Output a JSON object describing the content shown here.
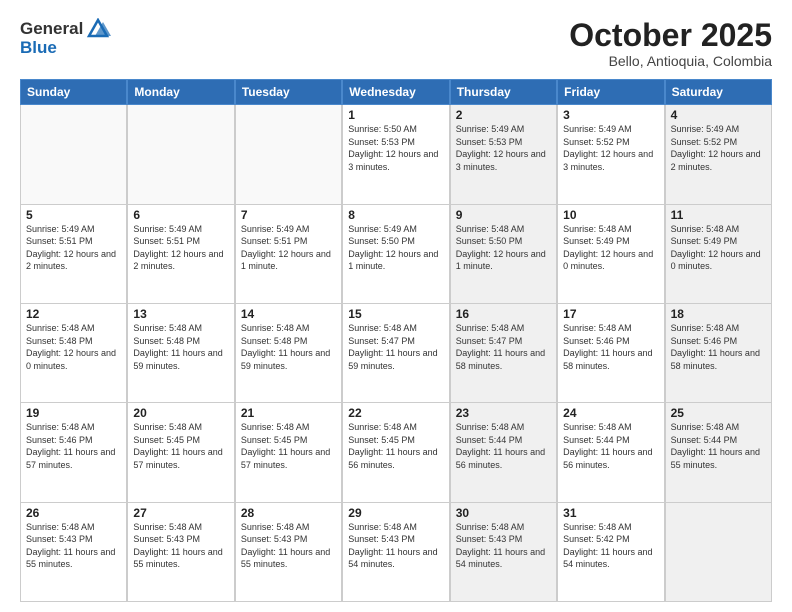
{
  "header": {
    "logo_general": "General",
    "logo_blue": "Blue",
    "month_title": "October 2025",
    "location": "Bello, Antioquia, Colombia"
  },
  "days_of_week": [
    "Sunday",
    "Monday",
    "Tuesday",
    "Wednesday",
    "Thursday",
    "Friday",
    "Saturday"
  ],
  "weeks": [
    [
      {
        "day": "",
        "sunrise": "",
        "sunset": "",
        "daylight": "",
        "shaded": false,
        "empty": true
      },
      {
        "day": "",
        "sunrise": "",
        "sunset": "",
        "daylight": "",
        "shaded": false,
        "empty": true
      },
      {
        "day": "",
        "sunrise": "",
        "sunset": "",
        "daylight": "",
        "shaded": false,
        "empty": true
      },
      {
        "day": "1",
        "sunrise": "Sunrise: 5:50 AM",
        "sunset": "Sunset: 5:53 PM",
        "daylight": "Daylight: 12 hours and 3 minutes.",
        "shaded": false,
        "empty": false
      },
      {
        "day": "2",
        "sunrise": "Sunrise: 5:49 AM",
        "sunset": "Sunset: 5:53 PM",
        "daylight": "Daylight: 12 hours and 3 minutes.",
        "shaded": true,
        "empty": false
      },
      {
        "day": "3",
        "sunrise": "Sunrise: 5:49 AM",
        "sunset": "Sunset: 5:52 PM",
        "daylight": "Daylight: 12 hours and 3 minutes.",
        "shaded": false,
        "empty": false
      },
      {
        "day": "4",
        "sunrise": "Sunrise: 5:49 AM",
        "sunset": "Sunset: 5:52 PM",
        "daylight": "Daylight: 12 hours and 2 minutes.",
        "shaded": true,
        "empty": false
      }
    ],
    [
      {
        "day": "5",
        "sunrise": "Sunrise: 5:49 AM",
        "sunset": "Sunset: 5:51 PM",
        "daylight": "Daylight: 12 hours and 2 minutes.",
        "shaded": false,
        "empty": false
      },
      {
        "day": "6",
        "sunrise": "Sunrise: 5:49 AM",
        "sunset": "Sunset: 5:51 PM",
        "daylight": "Daylight: 12 hours and 2 minutes.",
        "shaded": false,
        "empty": false
      },
      {
        "day": "7",
        "sunrise": "Sunrise: 5:49 AM",
        "sunset": "Sunset: 5:51 PM",
        "daylight": "Daylight: 12 hours and 1 minute.",
        "shaded": false,
        "empty": false
      },
      {
        "day": "8",
        "sunrise": "Sunrise: 5:49 AM",
        "sunset": "Sunset: 5:50 PM",
        "daylight": "Daylight: 12 hours and 1 minute.",
        "shaded": false,
        "empty": false
      },
      {
        "day": "9",
        "sunrise": "Sunrise: 5:48 AM",
        "sunset": "Sunset: 5:50 PM",
        "daylight": "Daylight: 12 hours and 1 minute.",
        "shaded": true,
        "empty": false
      },
      {
        "day": "10",
        "sunrise": "Sunrise: 5:48 AM",
        "sunset": "Sunset: 5:49 PM",
        "daylight": "Daylight: 12 hours and 0 minutes.",
        "shaded": false,
        "empty": false
      },
      {
        "day": "11",
        "sunrise": "Sunrise: 5:48 AM",
        "sunset": "Sunset: 5:49 PM",
        "daylight": "Daylight: 12 hours and 0 minutes.",
        "shaded": true,
        "empty": false
      }
    ],
    [
      {
        "day": "12",
        "sunrise": "Sunrise: 5:48 AM",
        "sunset": "Sunset: 5:48 PM",
        "daylight": "Daylight: 12 hours and 0 minutes.",
        "shaded": false,
        "empty": false
      },
      {
        "day": "13",
        "sunrise": "Sunrise: 5:48 AM",
        "sunset": "Sunset: 5:48 PM",
        "daylight": "Daylight: 11 hours and 59 minutes.",
        "shaded": false,
        "empty": false
      },
      {
        "day": "14",
        "sunrise": "Sunrise: 5:48 AM",
        "sunset": "Sunset: 5:48 PM",
        "daylight": "Daylight: 11 hours and 59 minutes.",
        "shaded": false,
        "empty": false
      },
      {
        "day": "15",
        "sunrise": "Sunrise: 5:48 AM",
        "sunset": "Sunset: 5:47 PM",
        "daylight": "Daylight: 11 hours and 59 minutes.",
        "shaded": false,
        "empty": false
      },
      {
        "day": "16",
        "sunrise": "Sunrise: 5:48 AM",
        "sunset": "Sunset: 5:47 PM",
        "daylight": "Daylight: 11 hours and 58 minutes.",
        "shaded": true,
        "empty": false
      },
      {
        "day": "17",
        "sunrise": "Sunrise: 5:48 AM",
        "sunset": "Sunset: 5:46 PM",
        "daylight": "Daylight: 11 hours and 58 minutes.",
        "shaded": false,
        "empty": false
      },
      {
        "day": "18",
        "sunrise": "Sunrise: 5:48 AM",
        "sunset": "Sunset: 5:46 PM",
        "daylight": "Daylight: 11 hours and 58 minutes.",
        "shaded": true,
        "empty": false
      }
    ],
    [
      {
        "day": "19",
        "sunrise": "Sunrise: 5:48 AM",
        "sunset": "Sunset: 5:46 PM",
        "daylight": "Daylight: 11 hours and 57 minutes.",
        "shaded": false,
        "empty": false
      },
      {
        "day": "20",
        "sunrise": "Sunrise: 5:48 AM",
        "sunset": "Sunset: 5:45 PM",
        "daylight": "Daylight: 11 hours and 57 minutes.",
        "shaded": false,
        "empty": false
      },
      {
        "day": "21",
        "sunrise": "Sunrise: 5:48 AM",
        "sunset": "Sunset: 5:45 PM",
        "daylight": "Daylight: 11 hours and 57 minutes.",
        "shaded": false,
        "empty": false
      },
      {
        "day": "22",
        "sunrise": "Sunrise: 5:48 AM",
        "sunset": "Sunset: 5:45 PM",
        "daylight": "Daylight: 11 hours and 56 minutes.",
        "shaded": false,
        "empty": false
      },
      {
        "day": "23",
        "sunrise": "Sunrise: 5:48 AM",
        "sunset": "Sunset: 5:44 PM",
        "daylight": "Daylight: 11 hours and 56 minutes.",
        "shaded": true,
        "empty": false
      },
      {
        "day": "24",
        "sunrise": "Sunrise: 5:48 AM",
        "sunset": "Sunset: 5:44 PM",
        "daylight": "Daylight: 11 hours and 56 minutes.",
        "shaded": false,
        "empty": false
      },
      {
        "day": "25",
        "sunrise": "Sunrise: 5:48 AM",
        "sunset": "Sunset: 5:44 PM",
        "daylight": "Daylight: 11 hours and 55 minutes.",
        "shaded": true,
        "empty": false
      }
    ],
    [
      {
        "day": "26",
        "sunrise": "Sunrise: 5:48 AM",
        "sunset": "Sunset: 5:43 PM",
        "daylight": "Daylight: 11 hours and 55 minutes.",
        "shaded": false,
        "empty": false
      },
      {
        "day": "27",
        "sunrise": "Sunrise: 5:48 AM",
        "sunset": "Sunset: 5:43 PM",
        "daylight": "Daylight: 11 hours and 55 minutes.",
        "shaded": false,
        "empty": false
      },
      {
        "day": "28",
        "sunrise": "Sunrise: 5:48 AM",
        "sunset": "Sunset: 5:43 PM",
        "daylight": "Daylight: 11 hours and 55 minutes.",
        "shaded": false,
        "empty": false
      },
      {
        "day": "29",
        "sunrise": "Sunrise: 5:48 AM",
        "sunset": "Sunset: 5:43 PM",
        "daylight": "Daylight: 11 hours and 54 minutes.",
        "shaded": false,
        "empty": false
      },
      {
        "day": "30",
        "sunrise": "Sunrise: 5:48 AM",
        "sunset": "Sunset: 5:43 PM",
        "daylight": "Daylight: 11 hours and 54 minutes.",
        "shaded": true,
        "empty": false
      },
      {
        "day": "31",
        "sunrise": "Sunrise: 5:48 AM",
        "sunset": "Sunset: 5:42 PM",
        "daylight": "Daylight: 11 hours and 54 minutes.",
        "shaded": false,
        "empty": false
      },
      {
        "day": "",
        "sunrise": "",
        "sunset": "",
        "daylight": "",
        "shaded": true,
        "empty": true
      }
    ]
  ]
}
